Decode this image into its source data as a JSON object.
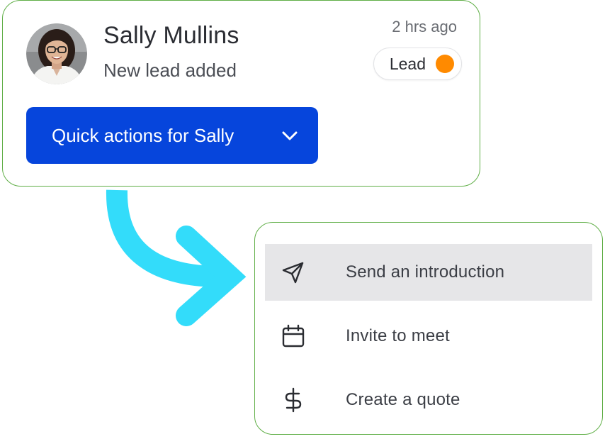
{
  "notification": {
    "contact_name": "Sally Mullins",
    "subtitle": "New lead added",
    "timestamp": "2 hrs ago",
    "status": {
      "label": "Lead",
      "dot_color": "#ff8a00"
    },
    "avatar_icon": "user-avatar-photo",
    "quick_actions": {
      "label": "Quick actions for Sally",
      "icon": "chevron-down-icon",
      "color": "#0645dc"
    }
  },
  "connector": {
    "icon": "curved-arrow-icon",
    "color": "#33dcfa"
  },
  "menu": {
    "items": [
      {
        "label": "Send an introduction",
        "icon": "send-icon",
        "active": true
      },
      {
        "label": "Invite to meet",
        "icon": "calendar-icon",
        "active": false
      },
      {
        "label": "Create a quote",
        "icon": "dollar-icon",
        "active": false
      }
    ]
  },
  "colors": {
    "card_border": "#5fae46",
    "active_item_bg": "#e6e6e8"
  }
}
